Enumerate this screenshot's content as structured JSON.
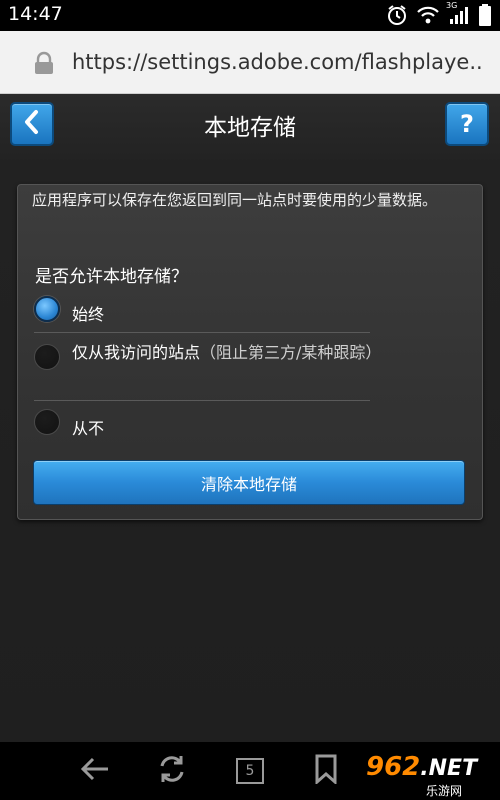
{
  "status_bar": {
    "time": "14:47",
    "network_label": "3G",
    "icons": [
      "alarm-icon",
      "wifi-icon",
      "signal-icon",
      "battery-icon"
    ]
  },
  "browser": {
    "url": "https://settings.adobe.com/flashplaye..",
    "lock_icon": "lock-icon"
  },
  "page": {
    "title": "本地存储",
    "back_icon": "back-chevron-icon",
    "help_label": "?",
    "description": "应用程序可以保存在您返回到同一站点时要使用的少量数据。",
    "question": "是否允许本地存储？",
    "options": [
      {
        "label": "始终",
        "hint": "",
        "selected": true
      },
      {
        "label": "仅从我访问的站点",
        "hint": "（阻止第三方/某种跟踪）",
        "selected": false
      },
      {
        "label": "从不",
        "hint": "",
        "selected": false
      }
    ],
    "clear_button": "清除本地存储"
  },
  "bottom_nav": {
    "tab_count": "5",
    "icons": [
      "back-arrow-icon",
      "refresh-icon",
      "tabs-icon",
      "bookmark-icon"
    ]
  },
  "watermark": {
    "logo_text": "962",
    "logo_suffix": ".NET",
    "sub_text": "乐游网"
  },
  "colors": {
    "accent_blue": "#2a8ad8",
    "panel_bg": "#3a3a3a",
    "watermark_orange": "#ff8a00"
  }
}
